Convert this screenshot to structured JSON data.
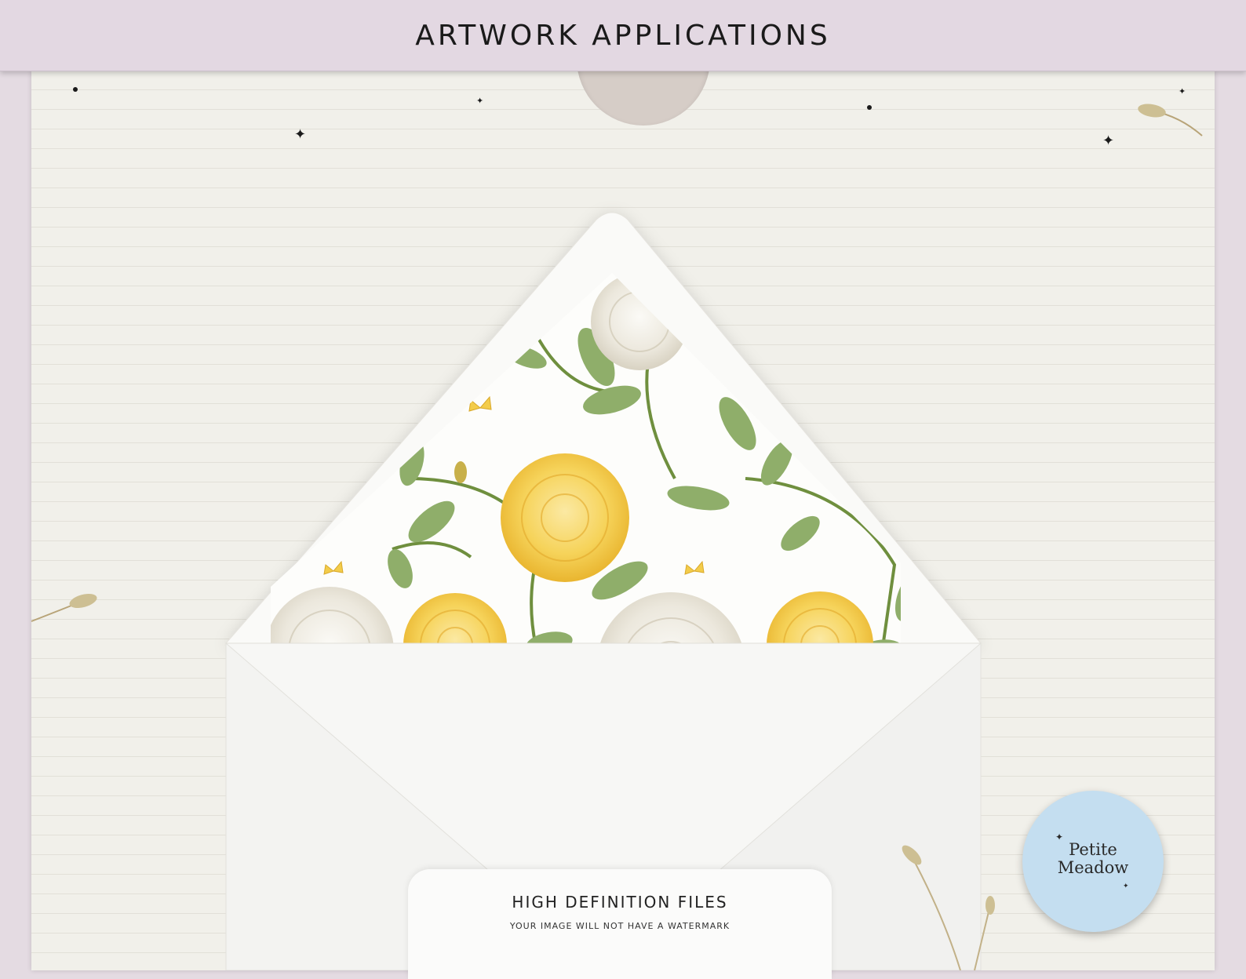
{
  "header": {
    "title": "ARTWORK APPLICATIONS"
  },
  "card": {
    "title": "HIGH DEFINITION FILES",
    "subtitle": "YOUR IMAGE WILL NOT HAVE A WATERMARK"
  },
  "logo": {
    "line1": "Petite",
    "line2": "Meadow"
  },
  "colors": {
    "header_bg": "#e3d8e2",
    "paper": "#f1f0ea",
    "logo_bg": "#c4def0",
    "flower_yellow": "#f6d35a",
    "flower_white": "#ece8dd",
    "leaf": "#8fae6a"
  },
  "icons": [
    "sparkle-icon",
    "butterfly-icon",
    "flower-bud-icon"
  ]
}
